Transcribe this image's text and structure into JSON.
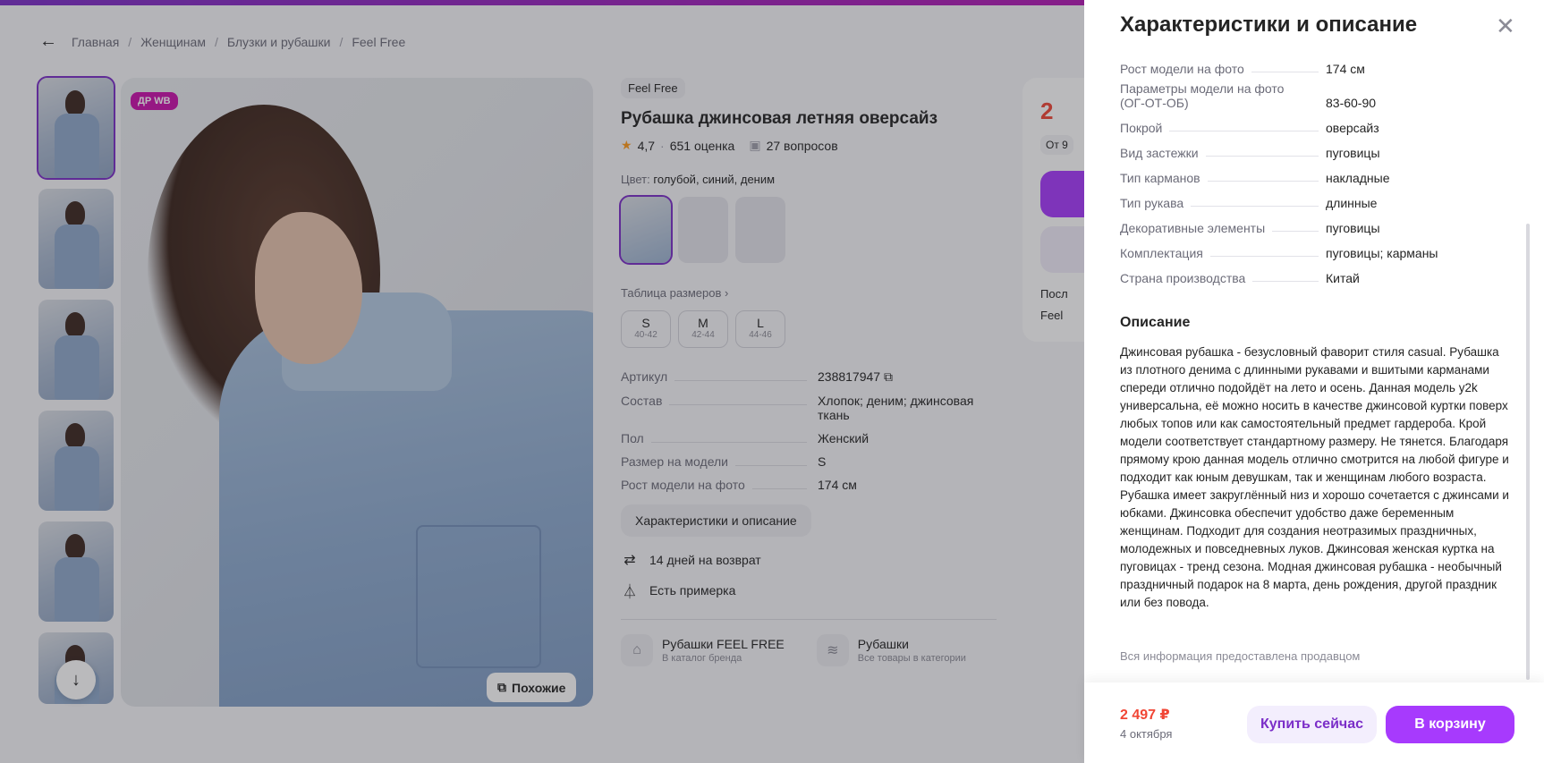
{
  "breadcrumb": [
    "Главная",
    "Женщинам",
    "Блузки и рубашки",
    "Feel Free"
  ],
  "gallery": {
    "badge": "ДР WB",
    "similar_label": "Похожие"
  },
  "product": {
    "brand": "Feel Free",
    "title": "Рубашка джинсовая летняя оверсайз",
    "rating": "4,7",
    "ratings_count": "651 оценка",
    "questions": "27 вопросов",
    "color_label": "Цвет:",
    "color_value": "голубой, синий, деним",
    "size_table_label": "Таблица размеров",
    "sizes": [
      {
        "size": "S",
        "range": "40-42"
      },
      {
        "size": "M",
        "range": "42-44"
      },
      {
        "size": "L",
        "range": "44-46"
      }
    ],
    "specs": [
      {
        "k": "Артикул",
        "v": "238817947"
      },
      {
        "k": "Состав",
        "v": "Хлопок; деним; джинсовая ткань"
      },
      {
        "k": "Пол",
        "v": "Женский"
      },
      {
        "k": "Размер на модели",
        "v": "S"
      },
      {
        "k": "Рост модели на фото",
        "v": "174 см"
      }
    ],
    "char_button": "Характеристики и описание",
    "perks": [
      "14 дней на возврат",
      "Есть примерка"
    ],
    "categories": [
      {
        "title": "Рубашки FEEL FREE",
        "sub": "В каталог бренда"
      },
      {
        "title": "Рубашки",
        "sub": "Все товары в категории"
      }
    ]
  },
  "buybox": {
    "price_fragment": "2",
    "from_fragment": "От 9",
    "line1": "Посл",
    "line2": "Feel"
  },
  "panel": {
    "title": "Характеристики и описание",
    "rows": [
      {
        "k": "Рост модели на фото",
        "v": "174 см"
      },
      {
        "k": "Параметры модели на фото (ОГ-ОТ-ОБ)",
        "v": "83-60-90"
      },
      {
        "k": "Покрой",
        "v": "оверсайз"
      },
      {
        "k": "Вид застежки",
        "v": "пуговицы"
      },
      {
        "k": "Тип карманов",
        "v": "накладные"
      },
      {
        "k": "Тип рукава",
        "v": "длинные"
      },
      {
        "k": "Декоративные элементы",
        "v": "пуговицы"
      },
      {
        "k": "Комплектация",
        "v": "пуговицы; карманы"
      },
      {
        "k": "Страна производства",
        "v": "Китай"
      }
    ],
    "description_title": "Описание",
    "description": "Джинсовая рубашка - безусловный фаворит стиля casual. Рубашка из плотного денима с длинными рукавами и вшитыми карманами спереди отлично подойдёт на лето и осень. Данная модель y2k универсальна, её можно носить в качестве джинсовой куртки поверх любых топов или как самостоятельный предмет гардероба. Крой модели соответствует стандартному размеру. Не тянется. Благодаря прямому крою данная модель отлично смотрится на любой фигуре и подходит как юным девушкам, так и женщинам любого возраста. Рубашка имеет закруглённый низ и хорошо сочетается с джинсами и юбками. Джинсовка обеспечит удобство даже беременным женщинам. Подходит для создания неотразимых праздничных, молодежных и повседневных луков. Джинсовая женская куртка на пуговицах - тренд сезона. Модная джинсовая рубашка - необычный праздничный подарок на 8 марта, день рождения, другой праздник или без повода.",
    "seller_note": "Вся информация предоставлена продавцом",
    "footer_price": "2 497 ₽",
    "footer_date": "4 октября",
    "buy_now": "Купить сейчас",
    "to_cart": "В корзину"
  },
  "colors": {
    "accent": "#a73afd",
    "price": "#f14635",
    "badge": "#cb11ab"
  }
}
